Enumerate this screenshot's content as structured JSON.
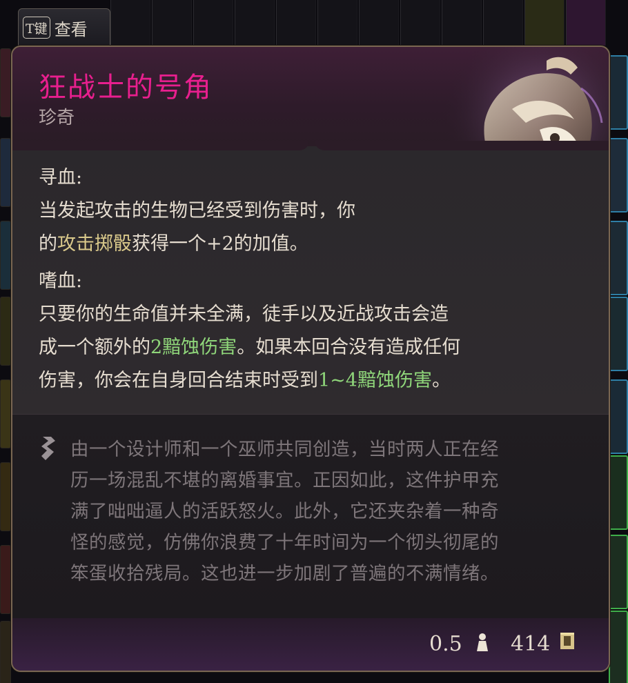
{
  "hint": {
    "key": "T键",
    "label": "查看"
  },
  "item": {
    "name": "狂战士的号角",
    "rarity": "珍奇",
    "name_color": "#e81f8e"
  },
  "effects": [
    {
      "title": "寻血:",
      "line1": "当发起攻击的生物已经受到伤害时，你",
      "line2_pre": "的",
      "line2_hl": "攻击掷骰",
      "line2_post": "获得一个+2的加值。"
    },
    {
      "title": "嗜血:",
      "line1": "只要你的生命值并未全满，徒手以及近战攻击会造",
      "line2_pre": "成一个额外的",
      "line2_hl": "2黯蚀伤害",
      "line2_post": "。如果本回合没有造成任何",
      "line3_pre": "伤害，你会在自身回合结束时受到",
      "line3_hl": "1~4黯蚀伤害",
      "line3_post": "。"
    }
  ],
  "lore": [
    "由一个设计师和一个巫师共同创造，当时两人正在经",
    "历一场混乱不堪的离婚事宜。正因如此，这件护甲充",
    "满了咄咄逼人的活跃怒火。此外，它还夹杂着一种奇",
    "怪的感觉，仿佛你浪费了十年时间为一个彻头彻尾的",
    "笨蛋收拾残局。这也进一步加剧了普遍的不满情绪。"
  ],
  "footer": {
    "weight": "0.5",
    "value": "414"
  },
  "icons": {
    "weight": "weight-icon",
    "gold": "gold-icon",
    "lore": "quote-icon"
  }
}
